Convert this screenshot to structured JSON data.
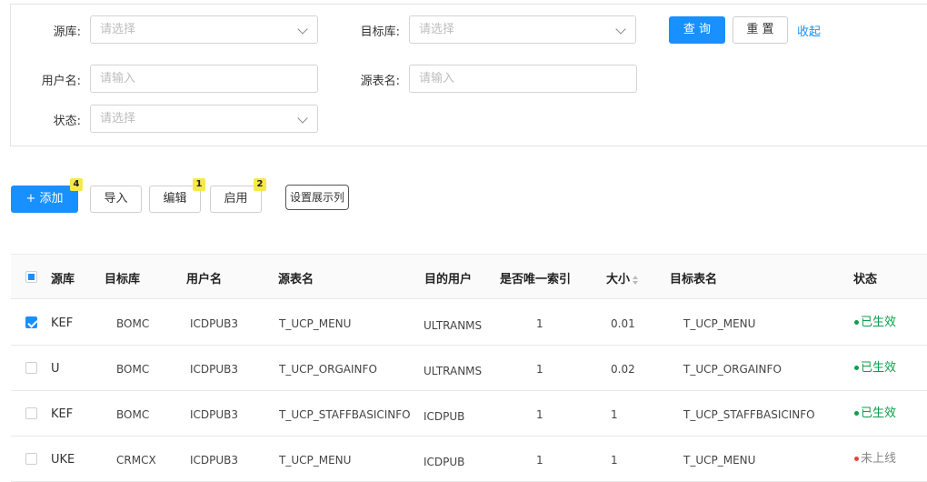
{
  "filters": {
    "source_db": {
      "label": "源库:",
      "placeholder": "请选择"
    },
    "target_db": {
      "label": "目标库:",
      "placeholder": "请选择"
    },
    "username": {
      "label": "用户名:",
      "placeholder": "请输入"
    },
    "source_table": {
      "label": "源表名:",
      "placeholder": "请输入"
    },
    "status": {
      "label": "状态:",
      "placeholder": "请选择"
    },
    "query_label": "查 询",
    "reset_label": "重 置",
    "collapse_label": "收起"
  },
  "toolbar": {
    "add_label": "+  添加",
    "add_badge": "4",
    "import_label": "导入",
    "edit_label": "编辑",
    "edit_badge": "1",
    "enable_label": "启用",
    "enable_badge": "2",
    "columns_label": "设置展示列"
  },
  "table": {
    "headers": {
      "source_db": "源库",
      "target_db": "目标库",
      "username": "用户名",
      "source_table": "源表名",
      "target_user": "目的用户",
      "unique_index": "是否唯一索引",
      "size": "大小",
      "target_table": "目标表名",
      "status": "状态"
    },
    "rows": [
      {
        "checked": true,
        "source_db": "KEF",
        "target_db": "BOMC",
        "username": "ICDPUB3",
        "source_table": "T_UCP_MENU",
        "target_user": "ULTRANMS",
        "unique_index": "1",
        "size": "0.01",
        "target_table": "T_UCP_MENU",
        "status": "已生效",
        "status_color": "#0c9e4a"
      },
      {
        "checked": false,
        "source_db": "U",
        "target_db": "BOMC",
        "username": "ICDPUB3",
        "source_table": "T_UCP_ORGAINFO",
        "target_user": "ULTRANMS",
        "unique_index": "1",
        "size": "0.02",
        "target_table": "T_UCP_ORGAINFO",
        "status": "已生效",
        "status_color": "#0c9e4a"
      },
      {
        "checked": false,
        "source_db": "KEF",
        "target_db": "BOMC",
        "username": "ICDPUB3",
        "source_table": "T_UCP_STAFFBASICINFO",
        "target_user": "ICDPUB",
        "unique_index": "1",
        "size": "1",
        "target_table": "T_UCP_STAFFBASICINFO",
        "status": "已生效",
        "status_color": "#0c9e4a"
      },
      {
        "checked": false,
        "source_db": "UKE",
        "target_db": "CRMCX",
        "username": "ICDPUB3",
        "source_table": "T_UCP_MENU",
        "target_user": "ICDPUB",
        "unique_index": "1",
        "size": "1",
        "target_table": "T_UCP_MENU",
        "status": "未上线",
        "status_color": "#e8453c"
      }
    ]
  },
  "colors": {
    "accent": "#1890ff",
    "active_status": "#0c9e4a",
    "inactive_dot": "#e8453c",
    "badge": "#f5e94a"
  }
}
